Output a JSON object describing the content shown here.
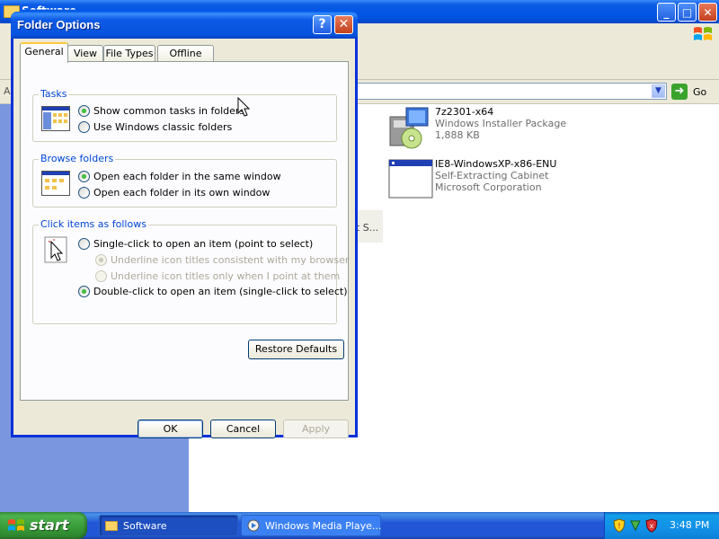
{
  "explorer": {
    "title": "Software",
    "address_label": "A",
    "go_label": "Go",
    "files": [
      {
        "name": "7z2301-x64",
        "type": "Windows Installer Package",
        "size": "1,888 KB",
        "icon": "installer-package-icon"
      },
      {
        "name": "IE8-WindowsXP-x86-ENU",
        "type": "Self-Extracting Cabinet",
        "size": "Microsoft Corporation",
        "icon": "application-window-icon"
      }
    ],
    "ghost_text": "t S..."
  },
  "dialog": {
    "title": "Folder Options",
    "help_label": "?",
    "close_label": "✕",
    "tabs": [
      "General",
      "View",
      "File Types",
      "Offline Files"
    ],
    "active_tab": "General",
    "groups": {
      "tasks": {
        "title": "Tasks",
        "options": [
          {
            "label": "Show common tasks in folders",
            "checked": true,
            "disabled": false
          },
          {
            "label": "Use Windows classic folders",
            "checked": false,
            "disabled": false
          }
        ]
      },
      "browse": {
        "title": "Browse folders",
        "options": [
          {
            "label": "Open each folder in the same window",
            "checked": true,
            "disabled": false
          },
          {
            "label": "Open each folder in its own window",
            "checked": false,
            "disabled": false
          }
        ]
      },
      "click": {
        "title": "Click items as follows",
        "options": [
          {
            "label": "Single-click to open an item (point to select)",
            "checked": false,
            "disabled": false
          },
          {
            "label": "Underline icon titles consistent with my browser",
            "checked": true,
            "disabled": true
          },
          {
            "label": "Underline icon titles only when I point at them",
            "checked": false,
            "disabled": true
          },
          {
            "label": "Double-click to open an item (single-click to select)",
            "checked": true,
            "disabled": false
          }
        ]
      }
    },
    "restore_label": "Restore Defaults",
    "ok_label": "OK",
    "cancel_label": "Cancel",
    "apply_label": "Apply"
  },
  "taskbar": {
    "start_label": "start",
    "tasks": [
      {
        "label": "Software",
        "icon": "folder-icon",
        "active": true
      },
      {
        "label": "Windows Media Playe...",
        "icon": "media-player-icon",
        "active": false
      }
    ],
    "clock": "3:48 PM"
  }
}
